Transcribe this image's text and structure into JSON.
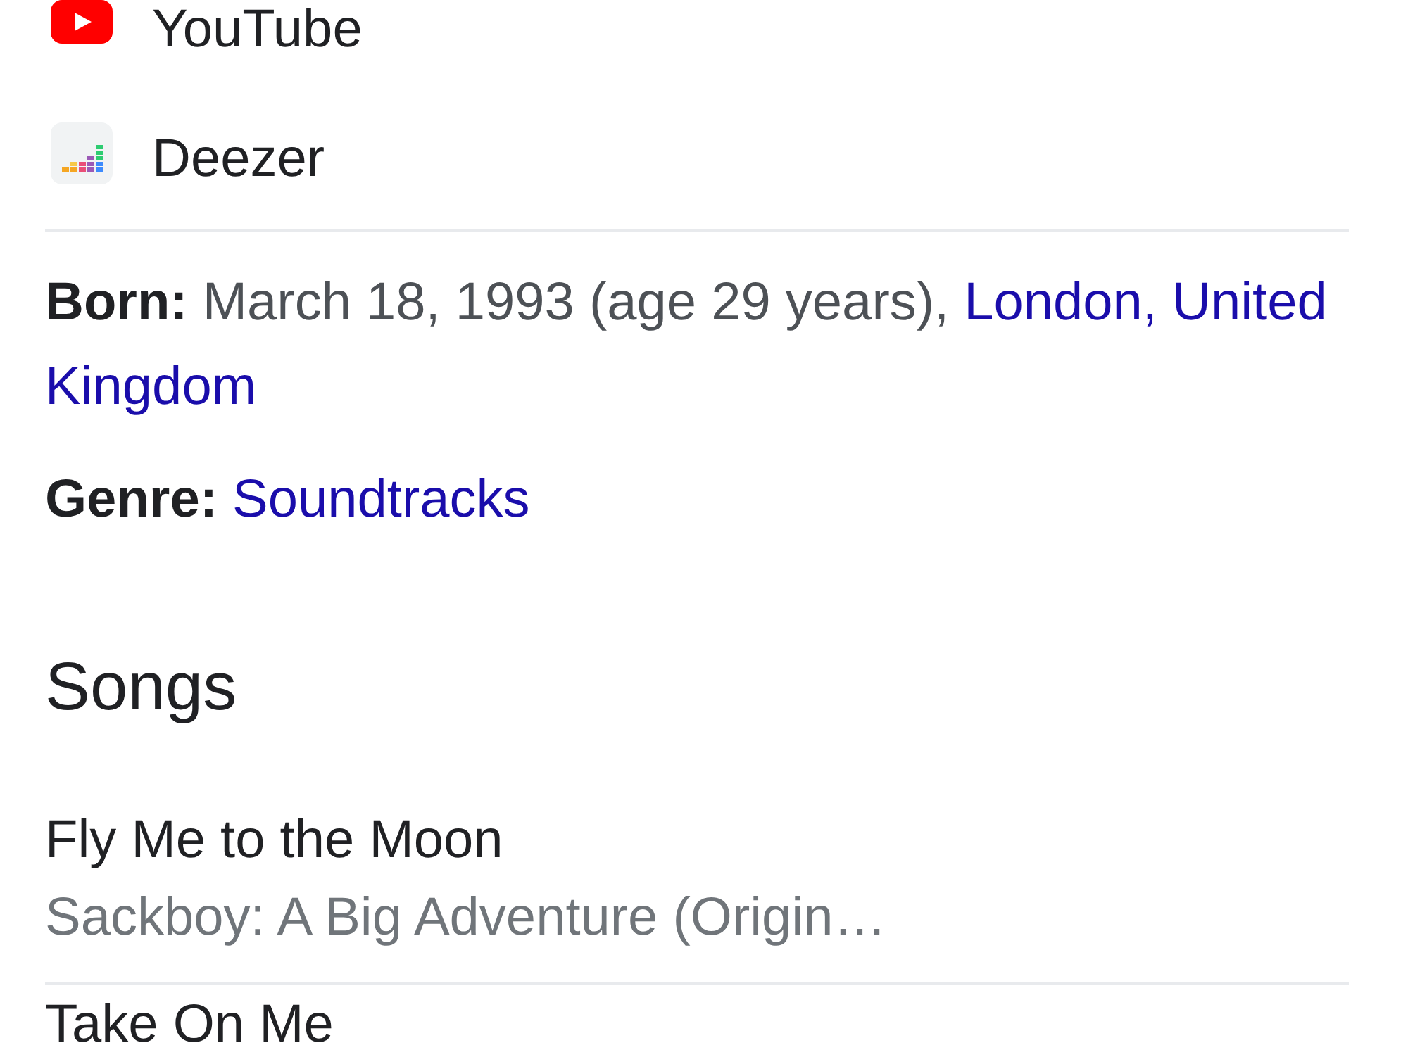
{
  "platforms": [
    {
      "name": "YouTube",
      "kind": "youtube"
    },
    {
      "name": "Deezer",
      "kind": "deezer"
    }
  ],
  "facts": [
    {
      "label": "Born:",
      "text": "March 18, 1993 (age 29 years),",
      "link_lines": [
        "London, United",
        "Kingdom"
      ]
    },
    {
      "label": "Genre:",
      "link_lines": [
        "Soundtracks"
      ]
    }
  ],
  "songs": {
    "heading": "Songs",
    "items": [
      {
        "title": "Fly Me to the Moon",
        "album": "Sackboy: A Big Adventure (Origin…"
      },
      {
        "title": "Take On Me"
      }
    ]
  }
}
